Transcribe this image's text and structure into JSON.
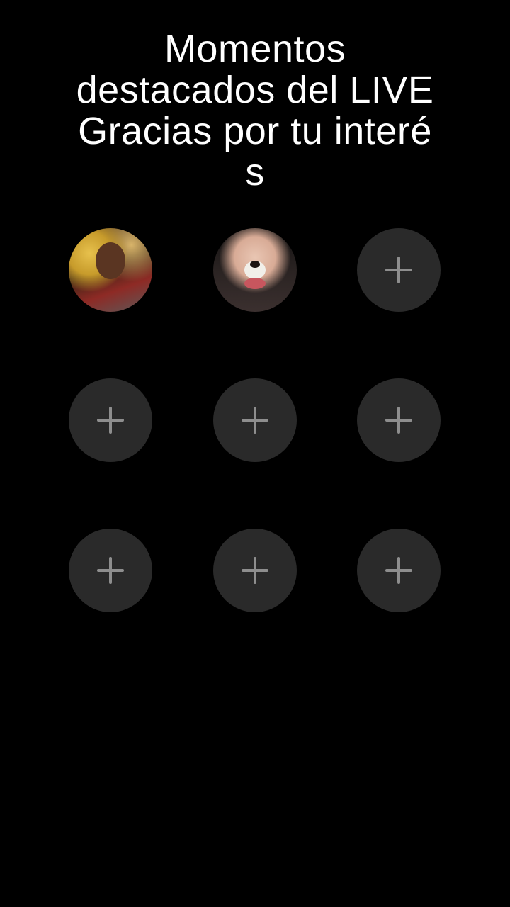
{
  "header": {
    "title_lines": [
      "Momentos",
      "destacados del LIVE",
      "Gracias por tu interé",
      "s"
    ]
  },
  "slots": [
    {
      "type": "avatar",
      "icon": "user-avatar-photo"
    },
    {
      "type": "avatar",
      "icon": "user-avatar-photo"
    },
    {
      "type": "add",
      "icon": "plus-icon"
    },
    {
      "type": "add",
      "icon": "plus-icon"
    },
    {
      "type": "add",
      "icon": "plus-icon"
    },
    {
      "type": "add",
      "icon": "plus-icon"
    },
    {
      "type": "add",
      "icon": "plus-icon"
    },
    {
      "type": "add",
      "icon": "plus-icon"
    },
    {
      "type": "add",
      "icon": "plus-icon"
    }
  ],
  "colors": {
    "background": "#000000",
    "slot_fill": "#2a2a2a",
    "plus": "#8e8e8e",
    "title": "#ffffff"
  }
}
